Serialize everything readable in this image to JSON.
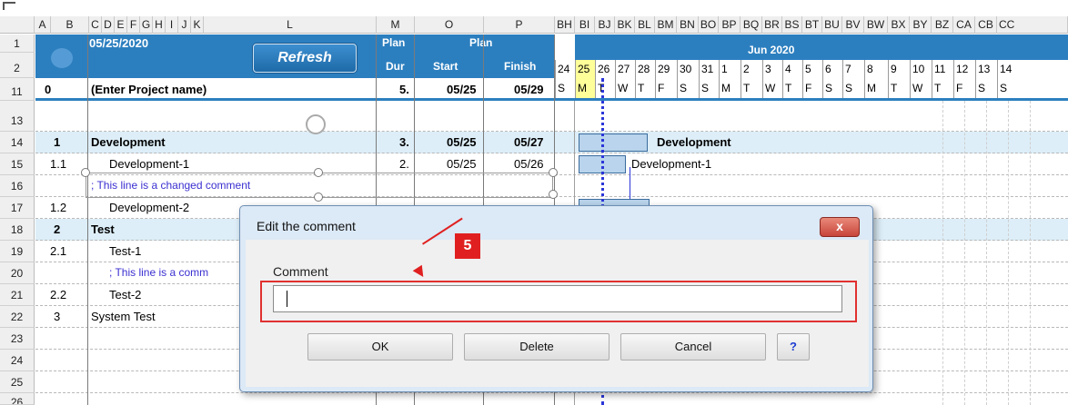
{
  "columns": {
    "left": [
      "A",
      "B",
      "C",
      "D",
      "E",
      "F",
      "G",
      "H",
      "I",
      "J",
      "K",
      "L",
      "M",
      "O",
      "P"
    ],
    "gantt": [
      "BH",
      "BI",
      "BJ",
      "BK",
      "BL",
      "BM",
      "BN",
      "BO",
      "BP",
      "BQ",
      "BR",
      "BS",
      "BT",
      "BU",
      "BV",
      "BW",
      "BX",
      "BY",
      "BZ",
      "CA",
      "CB",
      "CC"
    ]
  },
  "row_numbers": [
    "1",
    "2",
    "11",
    "13",
    "14",
    "15",
    "16",
    "17",
    "18",
    "19",
    "20",
    "21",
    "22",
    "23",
    "24",
    "25",
    "26"
  ],
  "header": {
    "date": "05/25/2020",
    "refresh_label": "Refresh",
    "plan_dur_top": "Plan",
    "plan_dur_bottom": "Dur",
    "plan_top": "Plan",
    "start": "Start",
    "finish": "Finish",
    "month": "Jun 2020",
    "days_nums": [
      "24",
      "25",
      "26",
      "27",
      "28",
      "29",
      "30",
      "31",
      "1",
      "2",
      "3",
      "4",
      "5",
      "6",
      "7",
      "8",
      "9",
      "10",
      "11",
      "12",
      "13",
      "14"
    ],
    "weekdays": [
      "S",
      "M",
      "T",
      "W",
      "T",
      "F",
      "S",
      "S",
      "M",
      "T",
      "W",
      "T",
      "F",
      "S",
      "S",
      "M",
      "T",
      "W",
      "T",
      "F",
      "S",
      "S"
    ]
  },
  "rows": [
    {
      "num": "0",
      "name": "(Enter Project name)",
      "dur": "5.",
      "start": "05/25",
      "finish": "05/29"
    },
    {
      "num": "1",
      "name": "Development",
      "dur": "3.",
      "start": "05/25",
      "finish": "05/27"
    },
    {
      "num": "1.1",
      "name": "Development-1",
      "dur": "2.",
      "start": "05/25",
      "finish": "05/26"
    },
    {
      "comment": "; This line is a changed comment"
    },
    {
      "num": "1.2",
      "name": "Development-2"
    },
    {
      "num": "2",
      "name": "Test"
    },
    {
      "num": "2.1",
      "name": "Test-1"
    },
    {
      "comment": "; This line is a comm"
    },
    {
      "num": "2.2",
      "name": "Test-2"
    },
    {
      "num": "3",
      "name": "System Test"
    }
  ],
  "gantt_labels": {
    "development": "Development",
    "development_1": "Development-1"
  },
  "dialog": {
    "title": "Edit the comment",
    "close_label": "x",
    "comment_label": "Comment",
    "comment_value": "",
    "ok": "OK",
    "delete": "Delete",
    "cancel": "Cancel",
    "help": "?"
  },
  "annotation": {
    "step": "5"
  },
  "colors": {
    "header_blue": "#2c7fbf",
    "summary_row": "#ddeef8",
    "today_highlight": "#ffff99",
    "annotation_red": "#e02020",
    "dialog_bg": "#dce9f6"
  }
}
